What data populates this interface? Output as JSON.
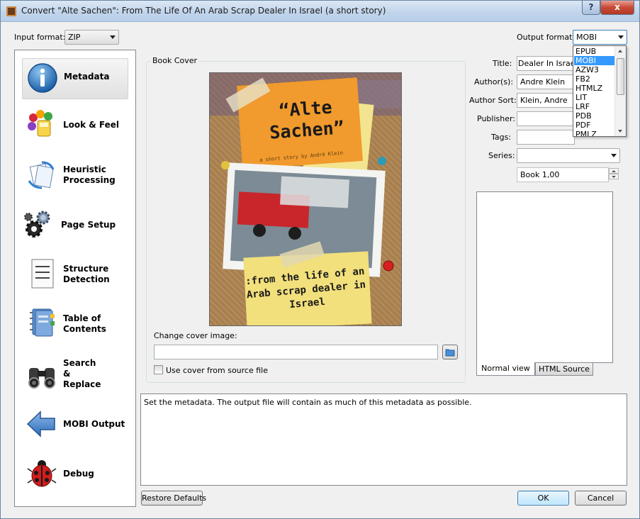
{
  "window": {
    "title": "Convert \"Alte Sachen\": From The Life Of An Arab Scrap Dealer In Israel (a short story)",
    "help_glyph": "?",
    "close_glyph": "x"
  },
  "input_format": {
    "label": "Input format:",
    "value": "ZIP"
  },
  "output_format": {
    "label": "Output format:",
    "value": "MOBI",
    "options": [
      "EPUB",
      "MOBI",
      "AZW3",
      "FB2",
      "HTMLZ",
      "LIT",
      "LRF",
      "PDB",
      "PDF",
      "PMLZ"
    ],
    "selected_index": 1
  },
  "sidebar": {
    "items": [
      {
        "label": "Metadata",
        "icon": "info-icon",
        "selected": true
      },
      {
        "label": "Look & Feel",
        "icon": "paint-palette-icon"
      },
      {
        "label": "Heuristic Processing",
        "icon": "heuristic-pages-icon"
      },
      {
        "label": "Page Setup",
        "icon": "gears-icon"
      },
      {
        "label": "Structure Detection",
        "icon": "document-icon"
      },
      {
        "label": "Table of Contents",
        "icon": "toc-book-icon"
      },
      {
        "label": "Search & Replace",
        "icon": "binoculars-icon"
      },
      {
        "label": "MOBI Output",
        "icon": "arrow-left-icon"
      },
      {
        "label": "Debug",
        "icon": "ladybug-icon"
      }
    ]
  },
  "book_cover": {
    "group_label": "Book Cover",
    "cover_title": "“Alte Sachen”",
    "cover_byline": "a short story by André Klein",
    "cover_subtitle": ":from the life of an Arab scrap dealer in Israel",
    "change_label": "Change cover image:",
    "path_value": "",
    "use_source_label": "Use cover from source file",
    "use_source_checked": false
  },
  "metadata": {
    "title_label": "Title:",
    "title_value": "Dealer In Israel (a",
    "authors_label": "Author(s):",
    "authors_value": "Andre Klein",
    "author_sort_label": "Author Sort:",
    "author_sort_value": "Klein, Andre",
    "publisher_label": "Publisher:",
    "publisher_value": "",
    "tags_label": "Tags:",
    "tags_value": "",
    "series_label": "Series:",
    "series_value": "",
    "series_index_value": "Book 1,00"
  },
  "comments_tabs": {
    "normal": "Normal view",
    "html": "HTML Source"
  },
  "help_text": "Set the metadata. The output file will contain as much of this metadata as possible.",
  "buttons": {
    "restore": "Restore Defaults",
    "ok": "OK",
    "cancel": "Cancel"
  }
}
